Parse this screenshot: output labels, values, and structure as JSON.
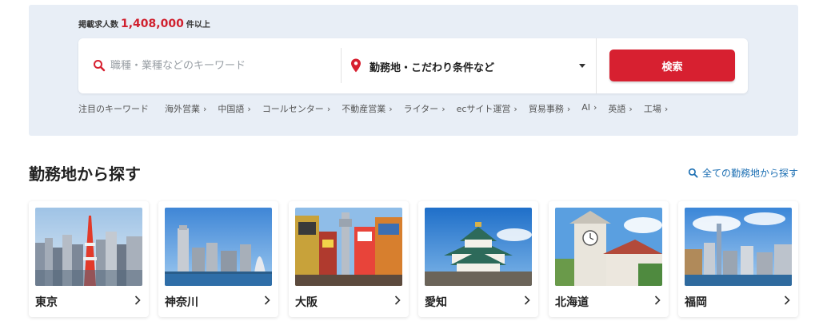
{
  "header": {
    "count_label": "掲載求人数",
    "count_value": "1,408,000",
    "count_suffix": "件以上"
  },
  "search": {
    "keyword_placeholder": "職種・業種などのキーワード",
    "location_label": "勤務地・こだわり条件など",
    "submit_label": "検索"
  },
  "keywords": {
    "title": "注目のキーワード",
    "items": [
      "海外営業",
      "中国語",
      "コールセンター",
      "不動産営業",
      "ライター",
      "ecサイト運営",
      "貿易事務",
      "AI",
      "英語",
      "工場"
    ],
    "chevron": "›"
  },
  "section": {
    "title": "勤務地から探す",
    "all_link": "全ての勤務地から探す"
  },
  "cities": [
    {
      "name": "東京"
    },
    {
      "name": "神奈川"
    },
    {
      "name": "大阪"
    },
    {
      "name": "愛知"
    },
    {
      "name": "北海道"
    },
    {
      "name": "福岡"
    }
  ],
  "colors": {
    "accent_red": "#d72030",
    "link_blue": "#1c6fb3",
    "panel_bg": "#e8eef6"
  }
}
